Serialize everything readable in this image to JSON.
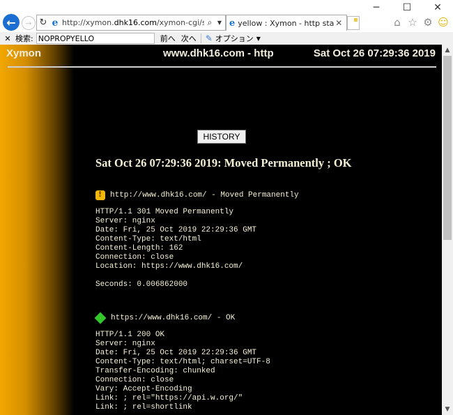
{
  "browser": {
    "address_url_prefix": "http://xymon.",
    "address_url_domain": "dhk16.com",
    "address_url_rest": "/xymon-cgi/svcstatu",
    "tab_title": "yellow : Xymon - http status ...",
    "find_label": "検索:",
    "find_value": "NOPROPYELLO",
    "find_prev": "前へ",
    "find_next": "次へ",
    "options_label": "オプション"
  },
  "header": {
    "logo": "Xymon",
    "host": "www.dhk16.com - http",
    "date": "Sat Oct 26 07:29:36 2019"
  },
  "history_button": "HISTORY",
  "status_line": "Sat Oct 26 07:29:36 2019: Moved Permanently ; OK",
  "checks": [
    {
      "icon": "yellow-warning-icon",
      "title": "http://www.dhk16.com/ - Moved Permanently",
      "lines": [
        "HTTP/1.1 301 Moved Permanently",
        "Server: nginx",
        "Date: Fri, 25 Oct 2019 22:29:36 GMT",
        "Content-Type: text/html",
        "Content-Length: 162",
        "Connection: close",
        "Location: https://www.dhk16.com/",
        "",
        "Seconds: 0.006862000"
      ]
    },
    {
      "icon": "green-ok-icon",
      "title": "https://www.dhk16.com/ - OK",
      "lines": [
        "HTTP/1.1 200 OK",
        "Server: nginx",
        "Date: Fri, 25 Oct 2019 22:29:36 GMT",
        "Content-Type: text/html; charset=UTF-8",
        "Transfer-Encoding: chunked",
        "Connection: close",
        "Vary: Accept-Encoding",
        "Link: ; rel=\"https://api.w.org/\"",
        "Link: ; rel=shortlink"
      ]
    }
  ],
  "scroll": {
    "thumb_position_fraction": 0.0,
    "thumb_size_fraction": 0.53
  },
  "colors": {
    "background": "#000000",
    "text": "#f4f0d4",
    "accent_gradient": "#f2a700"
  }
}
